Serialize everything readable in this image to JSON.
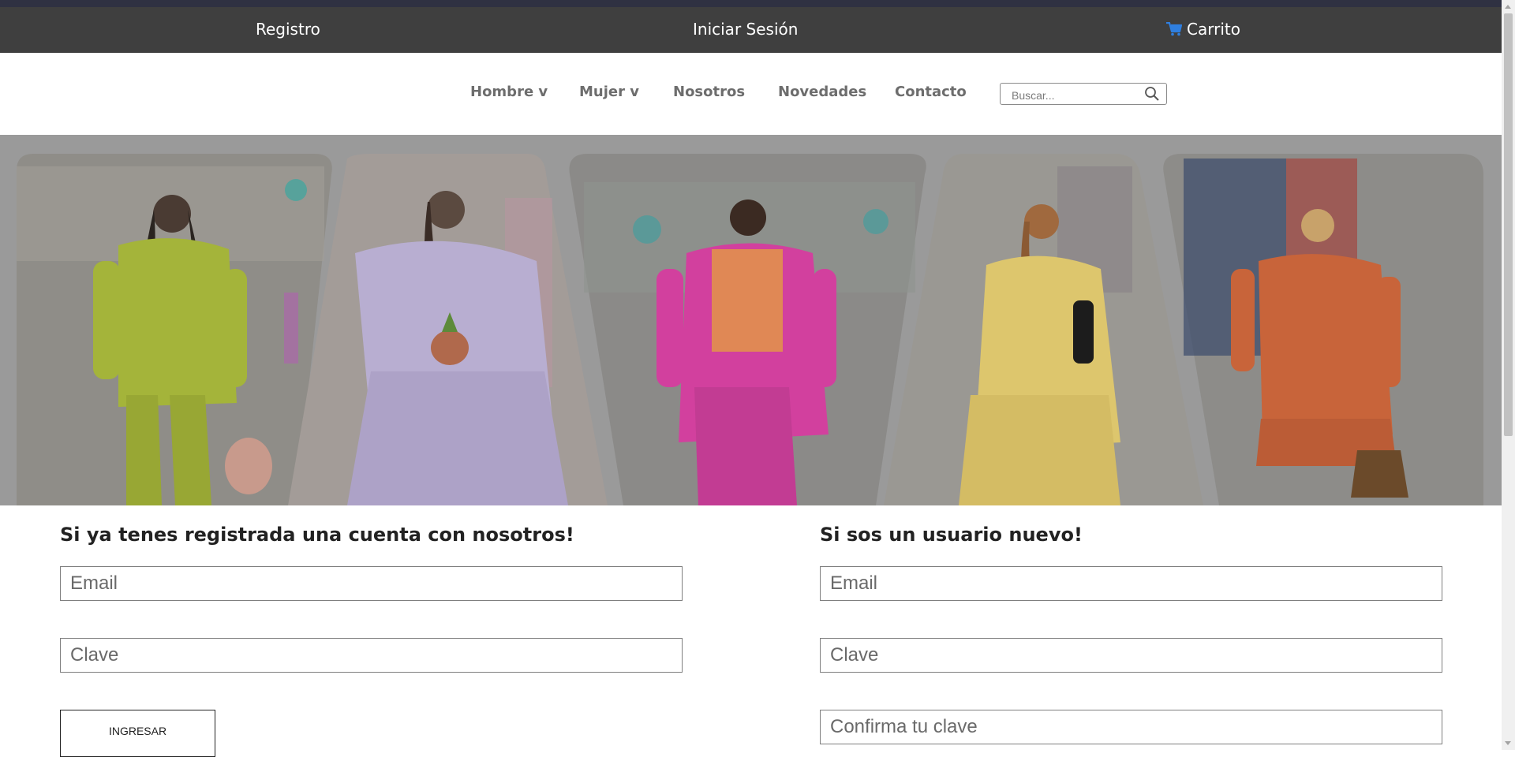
{
  "topbar": {
    "register": "Registro",
    "login": "Iniciar Sesión",
    "cart": "Carrito",
    "cart_icon": "shopping-cart-icon",
    "cart_icon_color": "#2f7fe0"
  },
  "nav": {
    "items": [
      "Hombre v",
      "Mujer v",
      "Nosotros",
      "Novedades",
      "Contacto"
    ],
    "search_placeholder": "Buscar...",
    "search_icon": "magnifier-icon"
  },
  "hero": {
    "overlay_color": "#9a9a9a",
    "outfit_colors": [
      "#a4b43a",
      "#b8aed1",
      "#d2409e",
      "#ddc66d",
      "#c8643a"
    ]
  },
  "login_section": {
    "title": "Si ya tenes registrada una cuenta con nosotros!",
    "email_placeholder": "Email",
    "password_placeholder": "Clave",
    "submit_label": "Ingresar"
  },
  "register_section": {
    "title": "Si sos un usuario nuevo!",
    "email_placeholder": "Email",
    "password_placeholder": "Clave",
    "confirm_placeholder": "Confirma tu clave"
  }
}
